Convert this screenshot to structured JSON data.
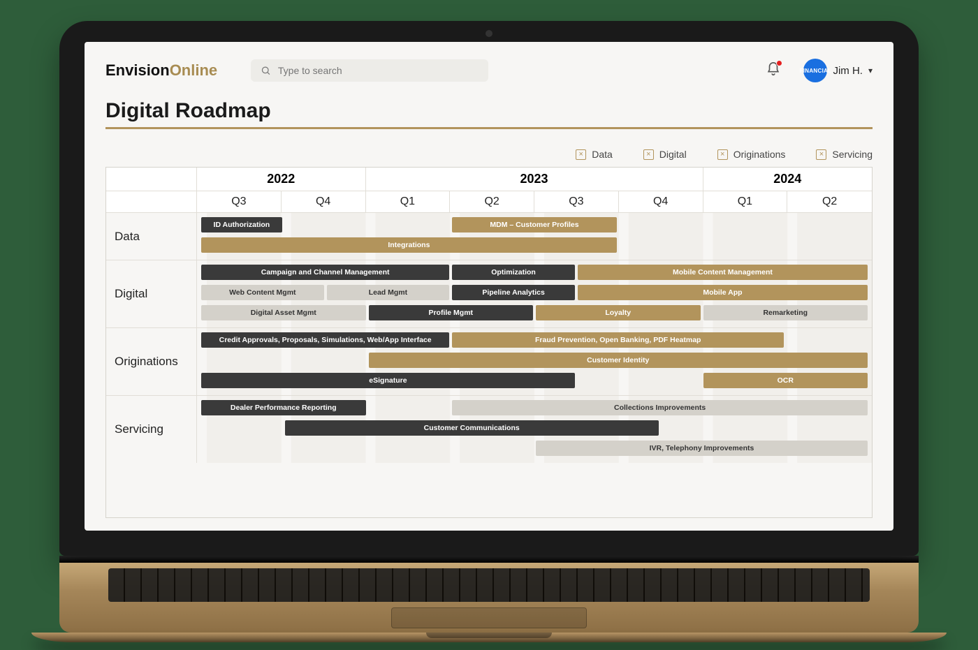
{
  "brand": {
    "part1": "Envision",
    "part2": "Online"
  },
  "search": {
    "placeholder": "Type to search"
  },
  "user": {
    "name": "Jim H.",
    "avatar_label": "FINANCIAL"
  },
  "page_title": "Digital Roadmap",
  "legend": [
    {
      "label": "Data"
    },
    {
      "label": "Digital"
    },
    {
      "label": "Originations"
    },
    {
      "label": "Servicing"
    }
  ],
  "years": [
    {
      "label": "2022",
      "span": 2
    },
    {
      "label": "2023",
      "span": 4
    },
    {
      "label": "2024",
      "span": 2
    }
  ],
  "quarters": [
    "Q3",
    "Q4",
    "Q1",
    "Q2",
    "Q3",
    "Q4",
    "Q1",
    "Q2"
  ],
  "categories": [
    {
      "name": "Data",
      "rows": 2,
      "bars": [
        {
          "label": "ID Authorization",
          "row": 1,
          "start": 1,
          "span": 2,
          "color": "dark"
        },
        {
          "label": "MDM – Customer Profiles",
          "row": 1,
          "start": 7,
          "span": 4,
          "color": "gold"
        },
        {
          "label": "Integrations",
          "row": 2,
          "start": 1,
          "span": 10,
          "color": "gold"
        }
      ]
    },
    {
      "name": "Digital",
      "rows": 3,
      "bars": [
        {
          "label": "Campaign and Channel Management",
          "row": 1,
          "start": 1,
          "span": 6,
          "color": "dark"
        },
        {
          "label": "Optimization",
          "row": 1,
          "start": 7,
          "span": 3,
          "color": "dark"
        },
        {
          "label": "Mobile Content Management",
          "row": 1,
          "start": 10,
          "span": 7,
          "color": "gold"
        },
        {
          "label": "Web Content Mgmt",
          "row": 2,
          "start": 1,
          "span": 3,
          "color": "grey"
        },
        {
          "label": "Lead Mgmt",
          "row": 2,
          "start": 4,
          "span": 3,
          "color": "grey"
        },
        {
          "label": "Pipeline Analytics",
          "row": 2,
          "start": 7,
          "span": 3,
          "color": "dark"
        },
        {
          "label": "Mobile App",
          "row": 2,
          "start": 10,
          "span": 7,
          "color": "gold"
        },
        {
          "label": "Digital Asset Mgmt",
          "row": 3,
          "start": 1,
          "span": 4,
          "color": "grey"
        },
        {
          "label": "Profile Mgmt",
          "row": 3,
          "start": 5,
          "span": 4,
          "color": "dark"
        },
        {
          "label": "Loyalty",
          "row": 3,
          "start": 9,
          "span": 4,
          "color": "gold"
        },
        {
          "label": "Remarketing",
          "row": 3,
          "start": 13,
          "span": 4,
          "color": "grey"
        }
      ]
    },
    {
      "name": "Originations",
      "rows": 3,
      "bars": [
        {
          "label": "Credit Approvals, Proposals, Simulations, Web/App Interface",
          "row": 1,
          "start": 1,
          "span": 6,
          "color": "dark"
        },
        {
          "label": "Fraud Prevention, Open Banking, PDF Heatmap",
          "row": 1,
          "start": 7,
          "span": 8,
          "color": "gold"
        },
        {
          "label": "Customer Identity",
          "row": 2,
          "start": 5,
          "span": 12,
          "color": "gold"
        },
        {
          "label": "eSignature",
          "row": 3,
          "start": 1,
          "span": 9,
          "color": "dark"
        },
        {
          "label": "OCR",
          "row": 3,
          "start": 13,
          "span": 4,
          "color": "gold"
        }
      ]
    },
    {
      "name": "Servicing",
      "rows": 3,
      "bars": [
        {
          "label": "Dealer Performance Reporting",
          "row": 1,
          "start": 1,
          "span": 4,
          "color": "dark"
        },
        {
          "label": "Collections Improvements",
          "row": 1,
          "start": 7,
          "span": 10,
          "color": "grey"
        },
        {
          "label": "Customer Communications",
          "row": 2,
          "start": 3,
          "span": 9,
          "color": "dark"
        },
        {
          "label": "IVR, Telephony Improvements",
          "row": 3,
          "start": 9,
          "span": 8,
          "color": "grey"
        }
      ]
    }
  ],
  "chart_data": {
    "type": "gantt",
    "title": "Digital Roadmap",
    "time_axis": {
      "unit": "quarter",
      "start": "2022-Q3",
      "end": "2024-Q2",
      "labels": [
        "2022 Q3",
        "2022 Q4",
        "2023 Q1",
        "2023 Q2",
        "2023 Q3",
        "2023 Q4",
        "2024 Q1",
        "2024 Q2"
      ]
    },
    "swimlanes": [
      "Data",
      "Digital",
      "Originations",
      "Servicing"
    ],
    "legend_colors": {
      "dark": "#3a3a3a",
      "gold": "#b2945c",
      "grey": "#d4d1ca"
    },
    "tasks": [
      {
        "lane": "Data",
        "name": "ID Authorization",
        "start": "2022-Q3",
        "end": "2022-Q3",
        "color": "dark"
      },
      {
        "lane": "Data",
        "name": "MDM – Customer Profiles",
        "start": "2023-Q2",
        "end": "2023-Q3",
        "color": "gold"
      },
      {
        "lane": "Data",
        "name": "Integrations",
        "start": "2022-Q3",
        "end": "2023-Q3",
        "color": "gold"
      },
      {
        "lane": "Digital",
        "name": "Campaign and Channel Management",
        "start": "2022-Q3",
        "end": "2023-Q1",
        "color": "dark"
      },
      {
        "lane": "Digital",
        "name": "Optimization",
        "start": "2023-Q2",
        "end": "2023-Q3",
        "color": "dark"
      },
      {
        "lane": "Digital",
        "name": "Mobile Content Management",
        "start": "2023-Q3",
        "end": "2024-Q2",
        "color": "gold"
      },
      {
        "lane": "Digital",
        "name": "Web Content Mgmt",
        "start": "2022-Q3",
        "end": "2022-Q4",
        "color": "grey"
      },
      {
        "lane": "Digital",
        "name": "Lead Mgmt",
        "start": "2022-Q4",
        "end": "2023-Q1",
        "color": "grey"
      },
      {
        "lane": "Digital",
        "name": "Pipeline Analytics",
        "start": "2023-Q2",
        "end": "2023-Q3",
        "color": "dark"
      },
      {
        "lane": "Digital",
        "name": "Mobile App",
        "start": "2023-Q3",
        "end": "2024-Q2",
        "color": "gold"
      },
      {
        "lane": "Digital",
        "name": "Digital Asset Mgmt",
        "start": "2022-Q3",
        "end": "2022-Q4",
        "color": "grey"
      },
      {
        "lane": "Digital",
        "name": "Profile Mgmt",
        "start": "2023-Q1",
        "end": "2023-Q2",
        "color": "dark"
      },
      {
        "lane": "Digital",
        "name": "Loyalty",
        "start": "2023-Q3",
        "end": "2023-Q4",
        "color": "gold"
      },
      {
        "lane": "Digital",
        "name": "Remarketing",
        "start": "2024-Q1",
        "end": "2024-Q2",
        "color": "grey"
      },
      {
        "lane": "Originations",
        "name": "Credit Approvals, Proposals, Simulations, Web/App Interface",
        "start": "2022-Q3",
        "end": "2023-Q1",
        "color": "dark"
      },
      {
        "lane": "Originations",
        "name": "Fraud Prevention, Open Banking, PDF Heatmap",
        "start": "2023-Q2",
        "end": "2024-Q1",
        "color": "gold"
      },
      {
        "lane": "Originations",
        "name": "Customer Identity",
        "start": "2023-Q1",
        "end": "2024-Q2",
        "color": "gold"
      },
      {
        "lane": "Originations",
        "name": "eSignature",
        "start": "2022-Q3",
        "end": "2023-Q3",
        "color": "dark"
      },
      {
        "lane": "Originations",
        "name": "OCR",
        "start": "2024-Q1",
        "end": "2024-Q2",
        "color": "gold"
      },
      {
        "lane": "Servicing",
        "name": "Dealer Performance Reporting",
        "start": "2022-Q3",
        "end": "2022-Q4",
        "color": "dark"
      },
      {
        "lane": "Servicing",
        "name": "Collections Improvements",
        "start": "2023-Q2",
        "end": "2024-Q2",
        "color": "grey"
      },
      {
        "lane": "Servicing",
        "name": "Customer Communications",
        "start": "2022-Q4",
        "end": "2023-Q4",
        "color": "dark"
      },
      {
        "lane": "Servicing",
        "name": "IVR, Telephony Improvements",
        "start": "2023-Q3",
        "end": "2024-Q2",
        "color": "grey"
      }
    ]
  }
}
